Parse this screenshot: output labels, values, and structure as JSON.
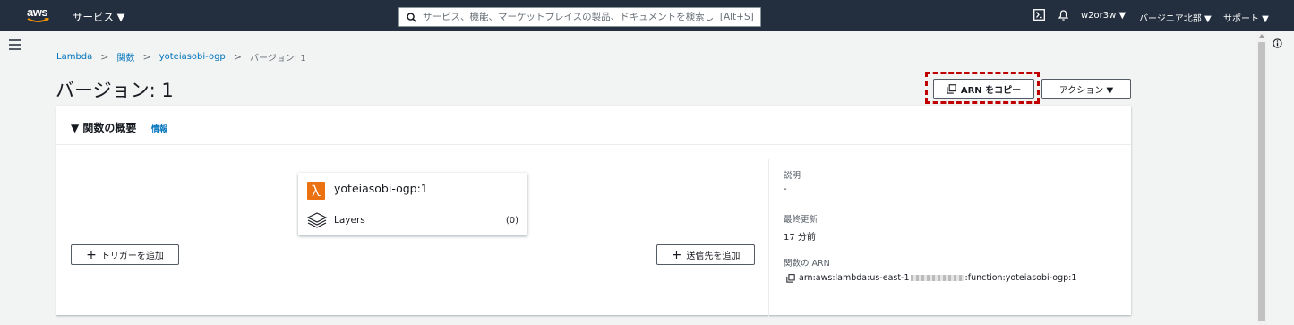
{
  "topbar": {
    "logo_text": "aws",
    "services_label": "サービス ▼",
    "search_placeholder": "サービス、機能、マーケットプレイスの製品、ドキュメントを検索し  [Alt+S]",
    "user_label": "w2or3w ▼",
    "region_label": "バージニア北部 ▼",
    "support_label": "サポート ▼"
  },
  "breadcrumb": {
    "items": [
      "Lambda",
      "関数",
      "yoteiasobi-ogp"
    ],
    "current": "バージョン: 1"
  },
  "page": {
    "title": "バージョン: 1",
    "copy_arn_label": "ARN をコピー",
    "actions_label": "アクション ▼"
  },
  "panel": {
    "title": "▼ 関数の概要",
    "info_link": "情報",
    "function_name": "yoteiasobi-ogp:1",
    "layers_label": "Layers",
    "layers_count": "(0)",
    "add_trigger_label": "トリガーを追加",
    "add_destination_label": "送信先を追加",
    "description_label": "説明",
    "description_value": "-",
    "last_modified_label": "最終更新",
    "last_modified_value": "17 分前",
    "arn_label": "関数の ARN",
    "arn_prefix": "arn:aws:lambda:us-east-1",
    "arn_suffix": ":function:yoteiasobi-ogp:1"
  },
  "colors": {
    "topbar_bg": "#232f3e",
    "link": "#0073bb",
    "lambda_orange": "#ec7211",
    "highlight_red": "#c00000"
  }
}
